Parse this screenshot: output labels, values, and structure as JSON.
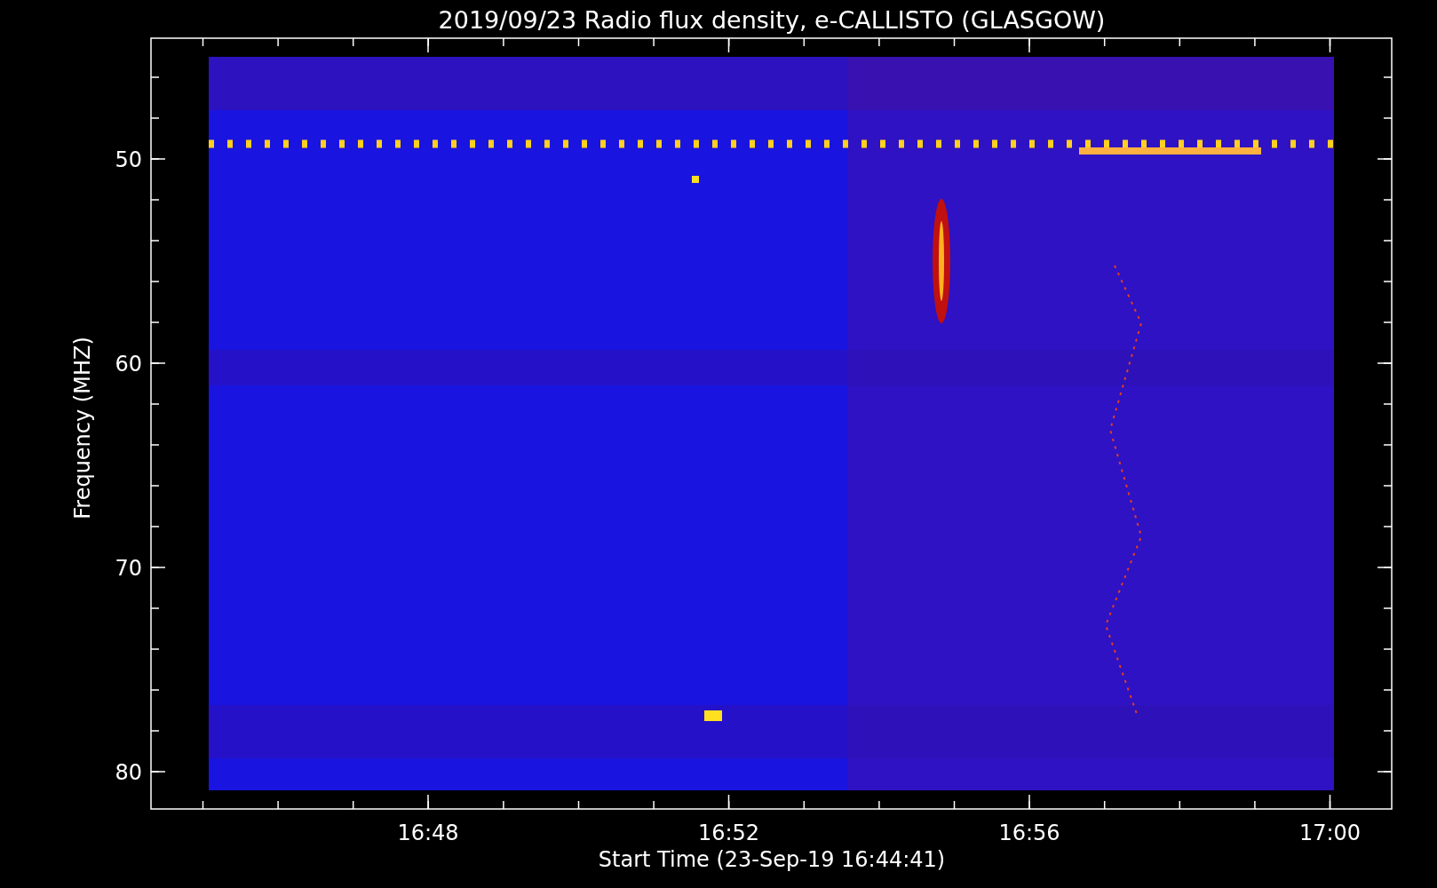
{
  "title": "2019/09/23  Radio flux density, e-CALLISTO (GLASGOW)",
  "y_axis": {
    "title": "Frequency (MHZ)",
    "ticks": [
      "50",
      "60",
      "70",
      "80"
    ]
  },
  "x_axis": {
    "title": "Start Time (23-Sep-19 16:44:41)",
    "ticks": [
      "16:48",
      "16:52",
      "16:56",
      "17:00"
    ]
  }
}
